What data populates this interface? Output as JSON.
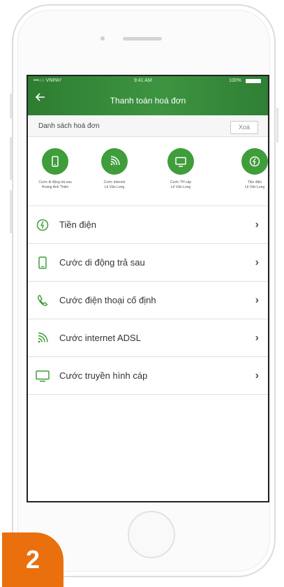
{
  "status_bar": {
    "carrier": "•••○○ VNPAY",
    "time": "9:41 AM",
    "battery": "100%"
  },
  "header": {
    "title": "Thanh toán hoá đơn"
  },
  "bills": {
    "title": "Danh sách hoá đơn",
    "delete_label": "Xoá"
  },
  "saved_bills": [
    {
      "icon": "mobile-phone-icon",
      "line1": "Cước di động trả sau",
      "line2": "Hoàng Anh Thiên"
    },
    {
      "icon": "wifi-signal-icon",
      "line1": "Cước internet",
      "line2": "Lê Văn Long"
    },
    {
      "icon": "tv-icon",
      "line1": "Cước TH cáp",
      "line2": "Lê Văn Long"
    },
    {
      "icon": "lightning-icon",
      "line1": "Tiền điện",
      "line2": "Lê Văn Long"
    }
  ],
  "menu": [
    {
      "icon": "lightning-icon",
      "label": "Tiền điện"
    },
    {
      "icon": "mobile-phone-icon",
      "label": "Cước di động trả sau"
    },
    {
      "icon": "telephone-icon",
      "label": "Cước điện thoại cố định"
    },
    {
      "icon": "wifi-signal-icon",
      "label": "Cước internet ADSL"
    },
    {
      "icon": "tv-icon",
      "label": "Cước truyền hình cáp"
    }
  ],
  "step_badge": "2",
  "colors": {
    "brand_green": "#3f9d3b",
    "header_green": "#2e7d32",
    "badge_orange": "#e9700d"
  }
}
